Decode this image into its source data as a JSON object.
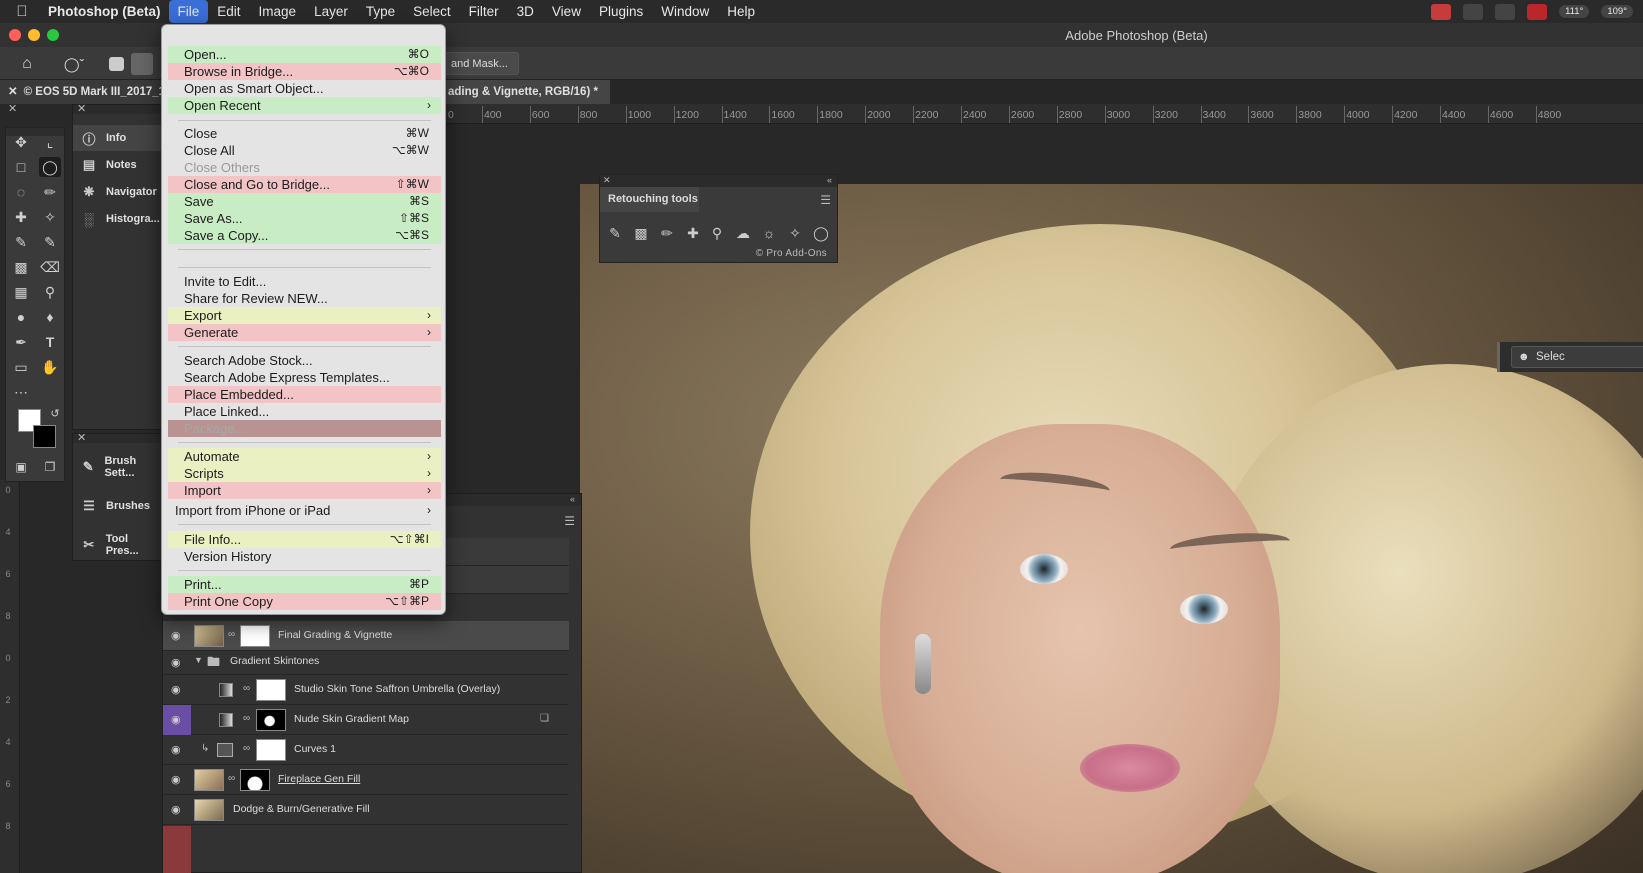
{
  "menubar": {
    "app_name": "Photoshop (Beta)",
    "items": [
      "File",
      "Edit",
      "Image",
      "Layer",
      "Type",
      "Select",
      "Filter",
      "3D",
      "View",
      "Plugins",
      "Window",
      "Help"
    ],
    "temp_a": "111°",
    "temp_b": "109°"
  },
  "window": {
    "title": "Adobe Photoshop (Beta)"
  },
  "options_bar": {
    "select_mask_label": "and Mask..."
  },
  "doc_tabs": {
    "tab1": "© EOS 5D Mark III_2017_1",
    "tab2": "ading & Vignette, RGB/16) *"
  },
  "ruler": {
    "labels": [
      "400",
      "600",
      "800",
      "1000",
      "1200",
      "1400",
      "1600",
      "1800",
      "2000",
      "2200",
      "2400",
      "2600",
      "2800",
      "3000",
      "3200",
      "3400",
      "3600",
      "3800",
      "4000",
      "4200",
      "4400",
      "4600",
      "4800"
    ],
    "zero_label": "0",
    "vertical_labels": [
      "0",
      "4",
      "6",
      "8",
      "0",
      "2",
      "4",
      "6",
      "8"
    ]
  },
  "panels": {
    "group1": [
      "Info",
      "Notes",
      "Navigator",
      "Histogra..."
    ],
    "group2": [
      "Brush Sett...",
      "Brushes",
      "Tool Pres..."
    ]
  },
  "retouching": {
    "title": "Retouching tools",
    "credit": "© Pro Add-Ons"
  },
  "right_button": {
    "label": "Selec"
  },
  "layers": [
    {
      "name": "Final Grading & Vignette",
      "selected": true
    },
    {
      "name": "Gradient Skintones",
      "group": true
    },
    {
      "name": "Studio Skin Tone Saffron Umbrella (Overlay)"
    },
    {
      "name": "Nude Skin Gradient Map"
    },
    {
      "name": "Curves 1"
    },
    {
      "name": "Fireplace Gen Fill"
    },
    {
      "name": "Dodge & Burn/Generative Fill"
    }
  ],
  "file_menu": {
    "items": [
      {
        "label": "Open...",
        "shortcut": "⌘O",
        "color": "green"
      },
      {
        "label": "Browse in Bridge...",
        "shortcut": "⌥⌘O",
        "color": "pink"
      },
      {
        "label": "Open as Smart Object...",
        "shortcut": "",
        "color": ""
      },
      {
        "label": "Open Recent",
        "shortcut": "",
        "color": "green",
        "submenu": true
      },
      {
        "label": "Close",
        "shortcut": "⌘W",
        "color": ""
      },
      {
        "label": "Close All",
        "shortcut": "⌥⌘W",
        "color": ""
      },
      {
        "label": "Close Others",
        "shortcut": "",
        "color": "",
        "disabled": true
      },
      {
        "label": "Close and Go to Bridge...",
        "shortcut": "⇧⌘W",
        "color": "pink"
      },
      {
        "label": "Save",
        "shortcut": "⌘S",
        "color": "green"
      },
      {
        "label": "Save As...",
        "shortcut": "⇧⌘S",
        "color": "green"
      },
      {
        "label": "Save a Copy...",
        "shortcut": "⌥⌘S",
        "color": "green"
      },
      {
        "label": "Invite to Edit...",
        "shortcut": "",
        "color": ""
      },
      {
        "label": "Share for Review NEW...",
        "shortcut": "",
        "color": ""
      },
      {
        "label": "Export",
        "shortcut": "",
        "color": "yellow",
        "submenu": true
      },
      {
        "label": "Generate",
        "shortcut": "",
        "color": "pink",
        "submenu": true
      },
      {
        "label": "Search Adobe Stock...",
        "shortcut": "",
        "color": ""
      },
      {
        "label": "Search Adobe Express Templates...",
        "shortcut": "",
        "color": ""
      },
      {
        "label": "Place Embedded...",
        "shortcut": "",
        "color": "pink"
      },
      {
        "label": "Place Linked...",
        "shortcut": "",
        "color": ""
      },
      {
        "label": "Package...",
        "shortcut": "",
        "color": "disbg"
      },
      {
        "label": "Automate",
        "shortcut": "",
        "color": "yellow",
        "submenu": true
      },
      {
        "label": "Scripts",
        "shortcut": "",
        "color": "yellow",
        "submenu": true
      },
      {
        "label": "Import",
        "shortcut": "",
        "color": "pink",
        "submenu": true
      },
      {
        "label": "Import from iPhone or iPad",
        "shortcut": "",
        "color": "",
        "submenu": true
      },
      {
        "label": "File Info...",
        "shortcut": "⌥⇧⌘I",
        "color": "yellow"
      },
      {
        "label": "Version History",
        "shortcut": "",
        "color": ""
      },
      {
        "label": "Print...",
        "shortcut": "⌘P",
        "color": "green"
      },
      {
        "label": "Print One Copy",
        "shortcut": "⌥⇧⌘P",
        "color": "pink"
      }
    ]
  },
  "colors": {
    "menu_green": "#c8ecc3",
    "menu_pink": "#f2c4c6",
    "menu_yellow": "#eaf0c2",
    "menubar_active": "#3b6fd8"
  },
  "icons": [
    "apple-icon",
    "home-icon",
    "lasso-icon",
    "move-icon",
    "crop-icon",
    "marquee-icon",
    "brush-icon",
    "eye-icon",
    "hamburger-icon",
    "close-icon"
  ]
}
